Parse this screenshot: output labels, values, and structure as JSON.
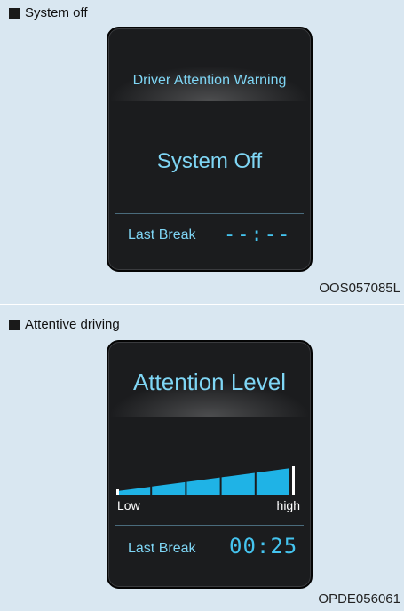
{
  "panel1": {
    "caption": "System off",
    "title": "Driver Attention Warning",
    "status": "System Off",
    "last_break_label": "Last Break",
    "last_break_value": "--:--",
    "code": "OOS057085L"
  },
  "panel2": {
    "caption": "Attentive driving",
    "title": "Attention Level",
    "level_low": "Low",
    "level_high": "high",
    "attention_level": 1.0,
    "last_break_label": "Last Break",
    "last_break_value": "00:25",
    "code": "OPDE056061"
  },
  "colors": {
    "text_blue": "#7fd6f5",
    "bar_blue": "#1fb3e6",
    "screen_bg": "#1b1c1e",
    "panel_bg": "#d9e7f1"
  }
}
